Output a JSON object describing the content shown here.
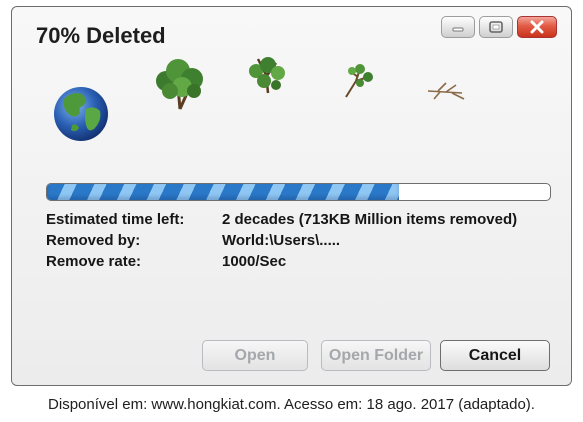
{
  "window": {
    "title": "70% Deleted",
    "controls": {
      "minimize": "minimize-icon",
      "maximize": "maximize-icon",
      "close": "close-icon"
    }
  },
  "illustration": [
    "earth-globe",
    "full-tree",
    "sparse-tree",
    "bare-tree",
    "fallen-branch"
  ],
  "progress": {
    "fraction": 0.7,
    "fill_color": "#2a78c8",
    "stripe_color": "#8ec6f4"
  },
  "info": {
    "rows": [
      {
        "label": "Estimated time left:",
        "value": "2 decades (713KB Million items removed)"
      },
      {
        "label": "Removed by:",
        "value": "World:\\Users\\....."
      },
      {
        "label": "Remove rate:",
        "value": "1000/Sec"
      }
    ]
  },
  "buttons": {
    "open": "Open",
    "open_folder": "Open Folder",
    "cancel": "Cancel"
  },
  "caption": "Disponível em: www.hongkiat.com. Acesso em: 18 ago. 2017 (adaptado)."
}
